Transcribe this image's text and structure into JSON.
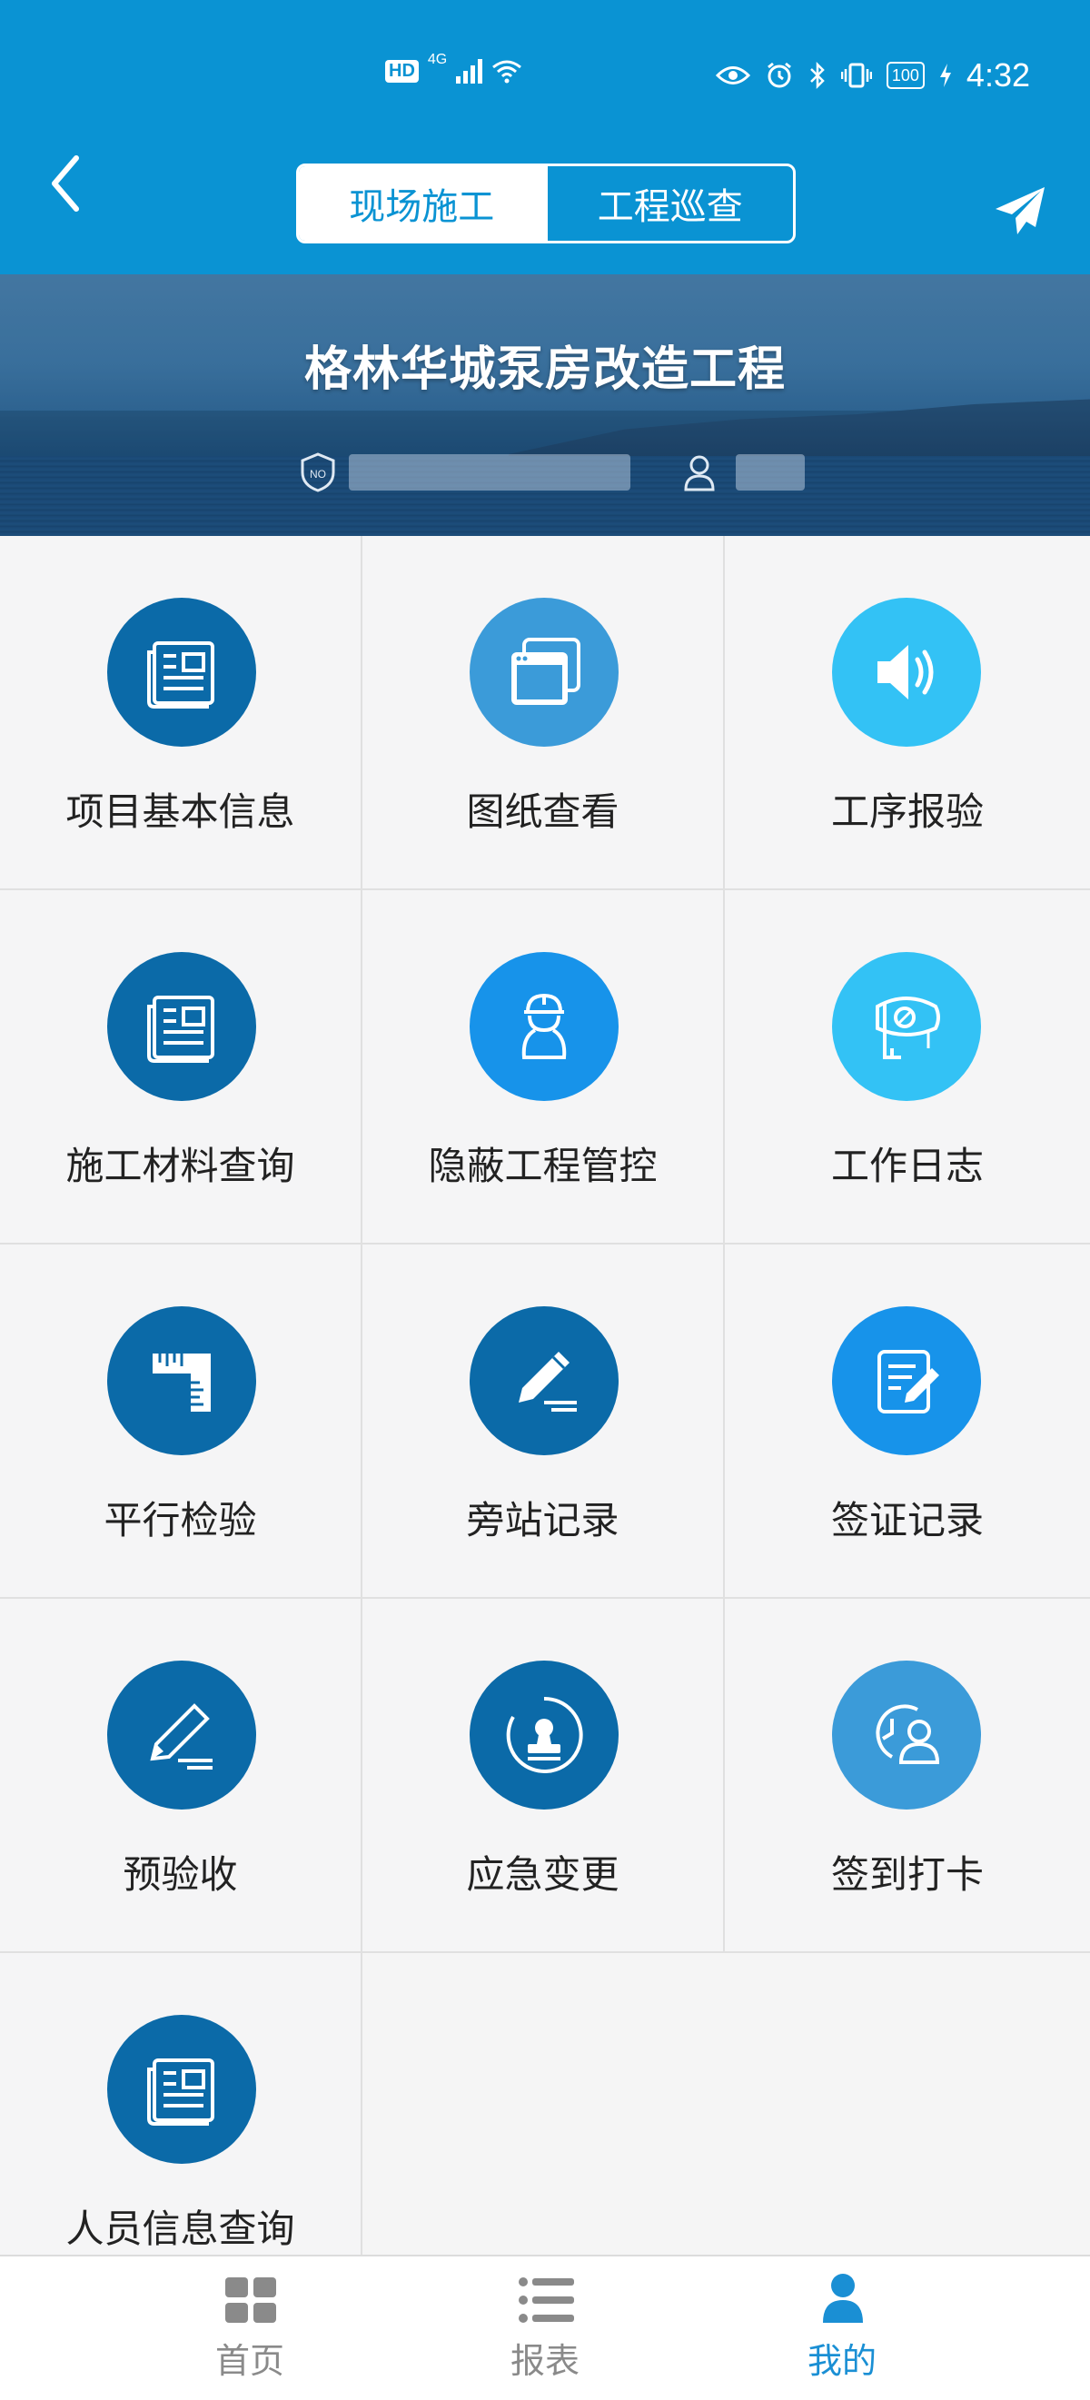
{
  "status_bar": {
    "hd": "HD",
    "network": "4G",
    "battery": "100",
    "time": "4:32"
  },
  "header": {
    "tabs": [
      {
        "label": "现场施工",
        "active": true
      },
      {
        "label": "工程巡查",
        "active": false
      }
    ]
  },
  "banner": {
    "title": "格林华城泵房改造工程",
    "no_badge": "NO"
  },
  "grid": {
    "items": [
      {
        "label": "项目基本信息",
        "icon": "news-document-icon",
        "color": "#0b6aa8"
      },
      {
        "label": "图纸查看",
        "icon": "window-stack-icon",
        "color": "#3b9bd9"
      },
      {
        "label": "工序报验",
        "icon": "speaker-icon",
        "color": "#33c2f5"
      },
      {
        "label": "施工材料查询",
        "icon": "news-document-icon",
        "color": "#0b6aa8"
      },
      {
        "label": "隐蔽工程管控",
        "icon": "worker-hardhat-icon",
        "color": "#1793ea"
      },
      {
        "label": "工作日志",
        "icon": "crane-icon",
        "color": "#33c2f5"
      },
      {
        "label": "平行检验",
        "icon": "ruler-icon",
        "color": "#0b6aa8"
      },
      {
        "label": "旁站记录",
        "icon": "pencil-sign-icon",
        "color": "#0b6aa8"
      },
      {
        "label": "签证记录",
        "icon": "edit-document-icon",
        "color": "#1793ea"
      },
      {
        "label": "预验收",
        "icon": "pencil-sign-icon",
        "color": "#0b6aa8"
      },
      {
        "label": "应急变更",
        "icon": "stamp-icon",
        "color": "#0b6aa8"
      },
      {
        "label": "签到打卡",
        "icon": "user-clock-icon",
        "color": "#3b9bd9"
      },
      {
        "label": "人员信息查询",
        "icon": "news-document-icon",
        "color": "#0b6aa8"
      }
    ]
  },
  "bottom_nav": {
    "tabs": [
      {
        "label": "首页",
        "icon": "grid-icon",
        "active": false
      },
      {
        "label": "报表",
        "icon": "list-icon",
        "active": false
      },
      {
        "label": "我的",
        "icon": "user-icon",
        "active": true
      }
    ],
    "active_color": "#1a8fd4",
    "inactive_color": "#8a8a8a"
  }
}
